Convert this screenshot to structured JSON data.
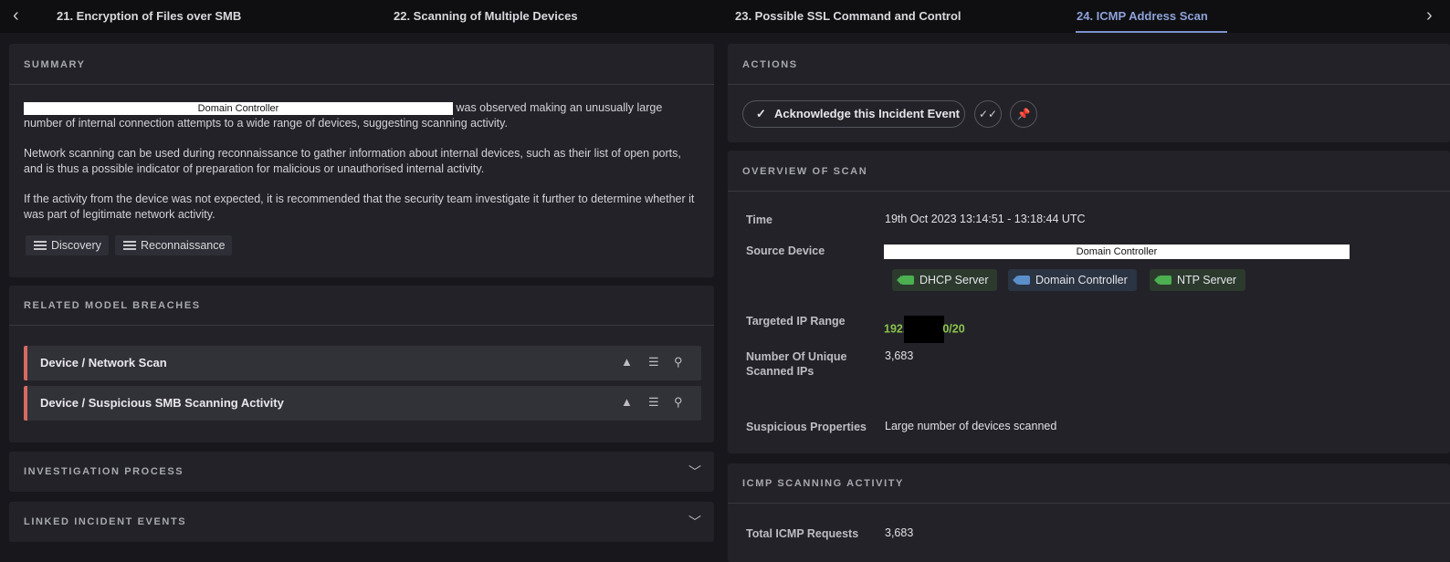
{
  "tabs": {
    "prev_arrow": "‹",
    "next_arrow": "›",
    "items": [
      {
        "label": "21. Encryption of Files over SMB"
      },
      {
        "label": "22. Scanning of Multiple Devices"
      },
      {
        "label": "23. Possible SSL Command and Control"
      },
      {
        "label": "24. ICMP Address Scan"
      }
    ]
  },
  "summary": {
    "heading": "SUMMARY",
    "device_label": "Domain Controller",
    "para1_rest": "was observed making an unusually large",
    "para1_line2": "number of internal connection attempts to a wide range of devices, suggesting scanning activity.",
    "para2": "Network scanning can be used during reconnaissance to gather information about internal devices, such as their list of open ports, and is thus a possible indicator of preparation for malicious or unauthorised internal activity.",
    "para3": "If the activity from the device was not expected, it is recommended that the security team investigate it further to determine whether it was part of legitimate network activity.",
    "tags": [
      "Discovery",
      "Reconnaissance"
    ]
  },
  "breaches": {
    "heading": "RELATED MODEL BREACHES",
    "items": [
      {
        "label": "Device / Network Scan"
      },
      {
        "label": "Device / Suspicious SMB Scanning Activity"
      }
    ]
  },
  "investigation": {
    "heading": "INVESTIGATION PROCESS"
  },
  "linked": {
    "heading": "LINKED INCIDENT EVENTS"
  },
  "actions": {
    "heading": "ACTIONS",
    "ack_label": "Acknowledge this Incident Event"
  },
  "overview": {
    "heading": "OVERVIEW OF SCAN",
    "time_key": "Time",
    "time_val": "19th Oct 2023 13:14:51 - 13:18:44 UTC",
    "source_key": "Source Device",
    "source_val": "Domain Controller",
    "source_tags": [
      {
        "label": "DHCP Server",
        "color": "#4caf50",
        "bg": "#2c3a2e"
      },
      {
        "label": "Domain Controller",
        "color": "#5b8fc9",
        "bg": "#2b3442"
      },
      {
        "label": "NTP Server",
        "color": "#4caf50",
        "bg": "#2c3a2e"
      }
    ],
    "range_key": "Targeted IP Range",
    "range_prefix": "192.",
    "range_suffix": "0/20",
    "range_color": "#8bc34a",
    "unique_key_1": "Number Of Unique",
    "unique_key_2": "Scanned IPs",
    "unique_val": "3,683",
    "susp_key": "Suspicious Properties",
    "susp_val": "Large number of devices scanned"
  },
  "icmp": {
    "heading": "ICMP SCANNING ACTIVITY",
    "total_key": "Total ICMP Requests",
    "total_val": "3,683"
  }
}
